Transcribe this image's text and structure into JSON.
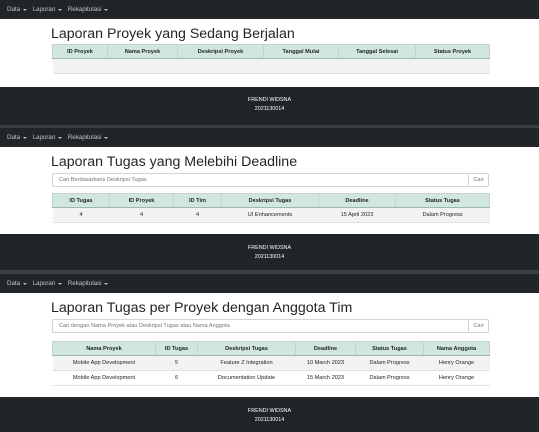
{
  "nav": {
    "data_label": "Data",
    "laporan_label": "Laporan",
    "rekap_label": "Rekapitulasi"
  },
  "section1": {
    "title": "Laporan Proyek yang Sedang Berjalan",
    "headers": [
      "ID Proyek",
      "Nama Proyek",
      "Deskripsi Proyek",
      "Tanggal Mulai",
      "Tanggal Selesai",
      "Status Proyek"
    ]
  },
  "section2": {
    "title": "Laporan Tugas yang Melebihi Deadline",
    "search_placeholder": "Cari Berdasarkans Deskripsi Tugas",
    "search_button": "Cari",
    "headers": [
      "ID Tugas",
      "ID Proyek",
      "ID Tim",
      "Deskripsi Tugas",
      "Deadline",
      "Status Tugas"
    ],
    "rows": [
      [
        "4",
        "4",
        "4",
        "UI Enhancements",
        "15 April 2023",
        "Dalam Progress"
      ]
    ]
  },
  "section3": {
    "title": "Laporan Tugas per Proyek dengan Anggota Tim",
    "search_placeholder": "Cari dengan Nama Proyek atau Deskripsi Tugas atau Nama Anggota",
    "search_button": "Cari",
    "headers": [
      "Nama Proyek",
      "ID Tugas",
      "Deskripsi Tugas",
      "Deadline",
      "Status Tugas",
      "Nama Anggota"
    ],
    "rows": [
      [
        "Mobile App Development",
        "5",
        "Feature Z Integration",
        "10 March 2023",
        "Dalam Progress",
        "Henry Orange"
      ],
      [
        "Mobile App Development",
        "6",
        "Documentation Update",
        "15 March 2023",
        "Dalam Progress",
        "Henry Orange"
      ]
    ]
  },
  "footer": {
    "name": "FRENDI WIDSNA",
    "id": "2021130014"
  }
}
